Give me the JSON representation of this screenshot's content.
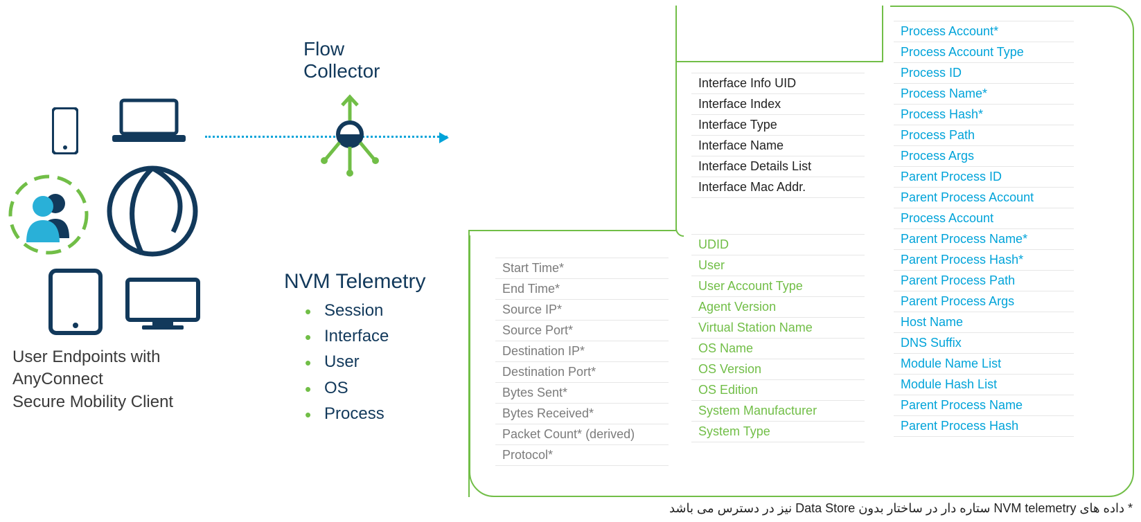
{
  "labels": {
    "flow_collector": "Flow\nCollector",
    "data_store": "Data Store",
    "endpoints": "User Endpoints with\nAnyConnect\nSecure Mobility Client",
    "telemetry_title": "NVM Telemetry"
  },
  "telemetry_items": [
    "Session",
    "Interface",
    "User",
    "OS",
    "Process"
  ],
  "tables": {
    "session": [
      "Start Time*",
      "End Time*",
      "Source IP*",
      "Source Port*",
      "Destination IP*",
      "Destination Port*",
      "Bytes Sent*",
      "Bytes Received*",
      "Packet Count* (derived)",
      "Protocol*"
    ],
    "interface": [
      "Interface Info UID",
      "Interface Index",
      "Interface Type",
      "Interface Name",
      "Interface Details List",
      "Interface Mac Addr."
    ],
    "user_os": [
      "UDID",
      "User",
      "User Account Type",
      "Agent Version",
      "Virtual Station Name",
      "OS Name",
      "OS Version",
      "OS Edition",
      "System Manufacturer",
      "System Type"
    ],
    "process": [
      "Process Account*",
      "Process Account Type",
      "Process ID",
      "Process Name*",
      "Process Hash*",
      "Process Path",
      "Process Args",
      "Parent Process ID",
      "Parent Process Account",
      "Process Account",
      "Parent Process Name*",
      "Parent Process Hash*",
      "Parent Process Path",
      "Parent Process Args",
      "Host Name",
      "DNS Suffix",
      "Module Name List",
      "Module Hash List",
      "Parent Process Name",
      "Parent Process Hash"
    ]
  },
  "footnote": "* داده های NVM telemetry ستاره دار در ساختار بدون Data Store نیز در دسترس می باشد",
  "colors": {
    "navy": "#12395b",
    "green": "#71be47",
    "cyan": "#00a3d9",
    "grey": "#7b7b7b"
  }
}
